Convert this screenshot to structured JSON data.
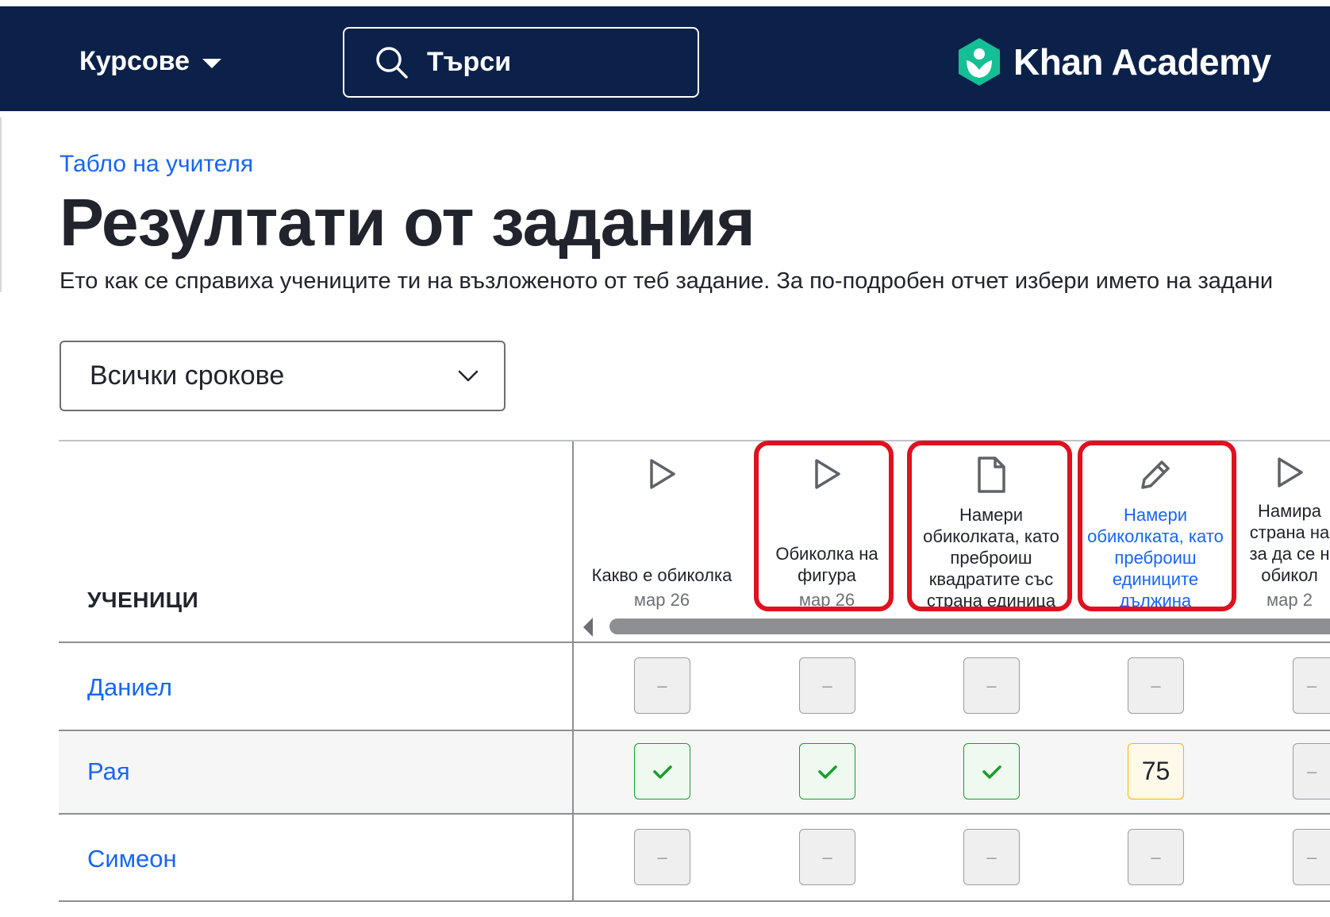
{
  "header": {
    "courses_label": "Курсове",
    "search_label": "Търси",
    "brand_name": "Khan Academy",
    "bg_color": "#0b2149"
  },
  "page": {
    "breadcrumb": "Табло на учителя",
    "title": "Резултати от задания",
    "subtitle": "Ето как се справиха учениците ти на възложеното от теб задание. За по-подробен отчет избери името на задани"
  },
  "filter": {
    "deadline_value": "Всички срокове"
  },
  "table": {
    "students_header": "УЧЕНИЦИ",
    "columns": [
      {
        "icon": "play-icon",
        "title_lines": [
          "Какво е обиколка"
        ],
        "date": "мар 26",
        "link": false
      },
      {
        "icon": "play-icon",
        "title_lines": [
          "Обиколка на",
          "фигура"
        ],
        "date": "мар 26",
        "link": false
      },
      {
        "icon": "article-icon",
        "title_lines": [
          "Намери",
          "обиколката, като",
          "преброиш",
          "квадратите със",
          "страна единица"
        ],
        "date": "",
        "link": false
      },
      {
        "icon": "pencil-icon",
        "title_lines": [
          "Намери",
          "обиколката, като",
          "преброиш",
          "единиците",
          "дължина"
        ],
        "date": "",
        "link": true
      },
      {
        "icon": "play-icon",
        "title_lines": [
          "Намира",
          "страна на",
          "за да се н",
          "обикол"
        ],
        "date": "мар 2",
        "link": false
      }
    ],
    "students": [
      {
        "name": "Даниел",
        "results": [
          "–",
          "–",
          "–",
          "–",
          "–"
        ]
      },
      {
        "name": "Рая",
        "results": [
          "done",
          "done",
          "done",
          "75",
          "–"
        ]
      },
      {
        "name": "Симеон",
        "results": [
          "–",
          "–",
          "–",
          "–",
          "–"
        ]
      }
    ],
    "highlight_color": "#e0101e",
    "status_colors": {
      "done": "#1a9d2b",
      "partial": "#ffb100",
      "empty": "#9a9ca0"
    }
  }
}
